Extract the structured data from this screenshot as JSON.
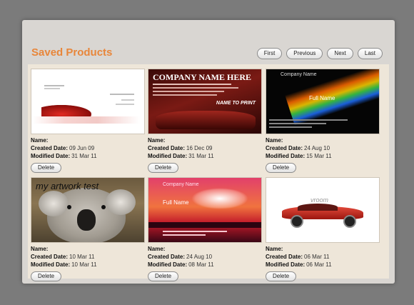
{
  "page": {
    "title": "Saved Products"
  },
  "pager": {
    "first": "First",
    "previous": "Previous",
    "next": "Next",
    "last": "Last"
  },
  "labels": {
    "name": "Name:",
    "created": "Created Date:",
    "modified": "Modified Date:",
    "delete": "Delete"
  },
  "products": [
    {
      "name": "",
      "created": "09 Jun 09",
      "modified": "31 Mar 11"
    },
    {
      "name": "",
      "created": "16 Dec 09",
      "modified": "31 Mar 11",
      "thumb_text": {
        "company": "COMPANY NAME HERE",
        "tag": "NAME TO PRINT"
      }
    },
    {
      "name": "",
      "created": "24 Aug 10",
      "modified": "15 Mar 11",
      "thumb_text": {
        "company": "Company Name",
        "full": "Full Name"
      }
    },
    {
      "name": "",
      "created": "10 Mar 11",
      "modified": "10 Mar 11",
      "thumb_text": {
        "caption": "my artwork test"
      }
    },
    {
      "name": "",
      "created": "24 Aug 10",
      "modified": "08 Mar 11",
      "thumb_text": {
        "company": "Company Name",
        "full": "Full Name"
      }
    },
    {
      "name": "",
      "created": "06 Mar 11",
      "modified": "06 Mar 11",
      "thumb_text": {
        "brand": "vroom"
      }
    }
  ],
  "colors": {
    "accent": "#e8863a",
    "panel": "#eee6d9",
    "backdrop": "#7b7b7b"
  }
}
